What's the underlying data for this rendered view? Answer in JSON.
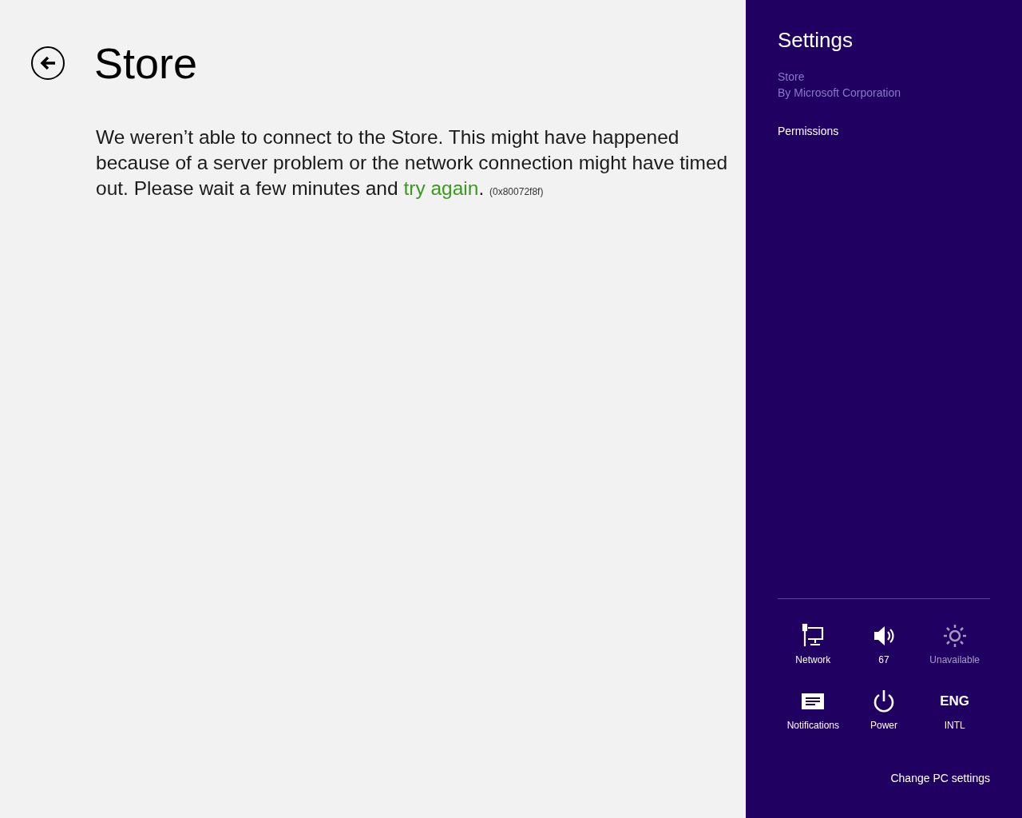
{
  "page": {
    "title": "Store",
    "message": {
      "before": "We weren’t able to connect to the Store. This might have happened because of a server problem or the network connection might have timed out. Please wait a few minutes and",
      "link": "try again",
      "after": ".",
      "code": "(0x80072f8f)"
    }
  },
  "settings_pane": {
    "title": "Settings",
    "app_name": "Store",
    "publisher": "By Microsoft Corporation",
    "items": [
      "Permissions"
    ],
    "tiles": [
      {
        "kind": "network",
        "label": "Network",
        "disabled": false
      },
      {
        "kind": "volume",
        "label": "67",
        "disabled": false
      },
      {
        "kind": "brightness",
        "label": "Unavailable",
        "disabled": true
      },
      {
        "kind": "notifications",
        "label": "Notifications",
        "disabled": false
      },
      {
        "kind": "power",
        "label": "Power",
        "disabled": false
      },
      {
        "kind": "keyboard",
        "glyph": "ENG",
        "label": "INTL",
        "disabled": false
      }
    ],
    "footer_link": "Change PC settings"
  }
}
